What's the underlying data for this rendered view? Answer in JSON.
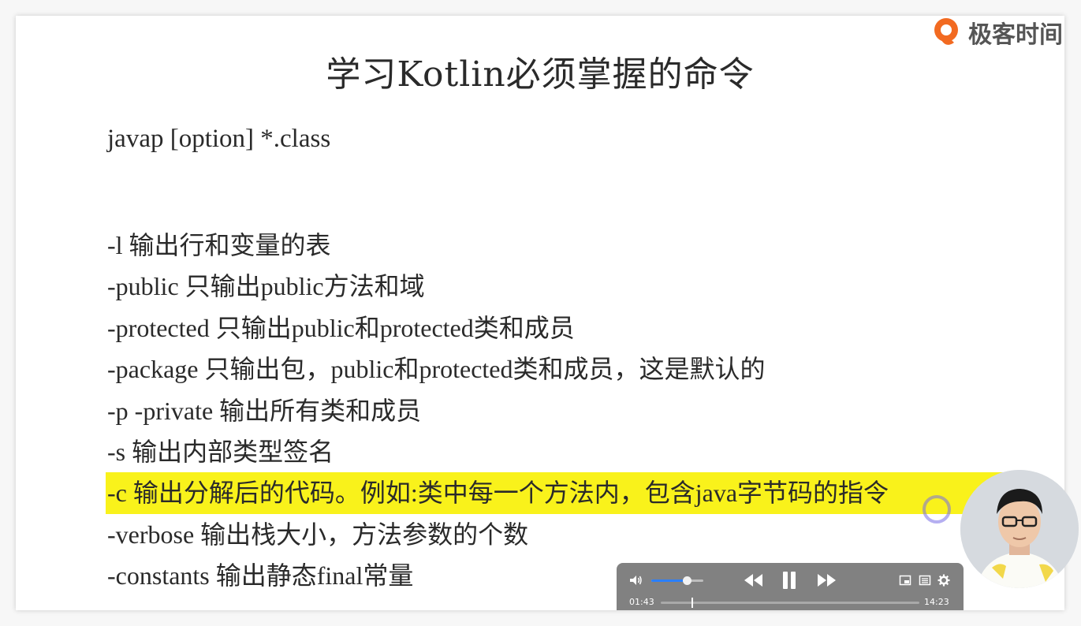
{
  "slide": {
    "title": "学习Kotlin必须掌握的命令",
    "syntax": "javap [option] *.class",
    "options": [
      {
        "flag": "-l",
        "desc": "输出行和变量的表",
        "highlighted": false
      },
      {
        "flag": "-public",
        "desc": "只输出public方法和域",
        "highlighted": false
      },
      {
        "flag": "-protected",
        "desc": "只输出public和protected类和成员",
        "highlighted": false
      },
      {
        "flag": "-package",
        "desc": "只输出包，public和protected类和成员，这是默认的",
        "highlighted": false
      },
      {
        "flag": "-p -private",
        "desc": "输出所有类和成员",
        "highlighted": false
      },
      {
        "flag": "-s",
        "desc": "输出内部类型签名",
        "highlighted": false
      },
      {
        "flag": "-c",
        "desc": "输出分解后的代码。例如:类中每一个方法内，包含java字节码的指令",
        "highlighted": true
      },
      {
        "flag": "-verbose",
        "desc": "输出栈大小，方法参数的个数",
        "highlighted": false
      },
      {
        "flag": "-constants",
        "desc": "输出静态final常量",
        "highlighted": false
      }
    ],
    "highlight_color": "#f9f21b"
  },
  "logo": {
    "text": "极客时间",
    "brand_color": "#f26a21"
  },
  "player": {
    "current_time": "01:43",
    "total_time": "14:23",
    "progress_fraction": 0.12,
    "volume_fraction": 0.68,
    "accent_color": "#2a7fff",
    "icons": [
      "volume-icon",
      "rewind-icon",
      "pause-icon",
      "fast-forward-icon",
      "picture-in-picture-icon",
      "chapters-icon",
      "settings-gear-icon"
    ]
  }
}
